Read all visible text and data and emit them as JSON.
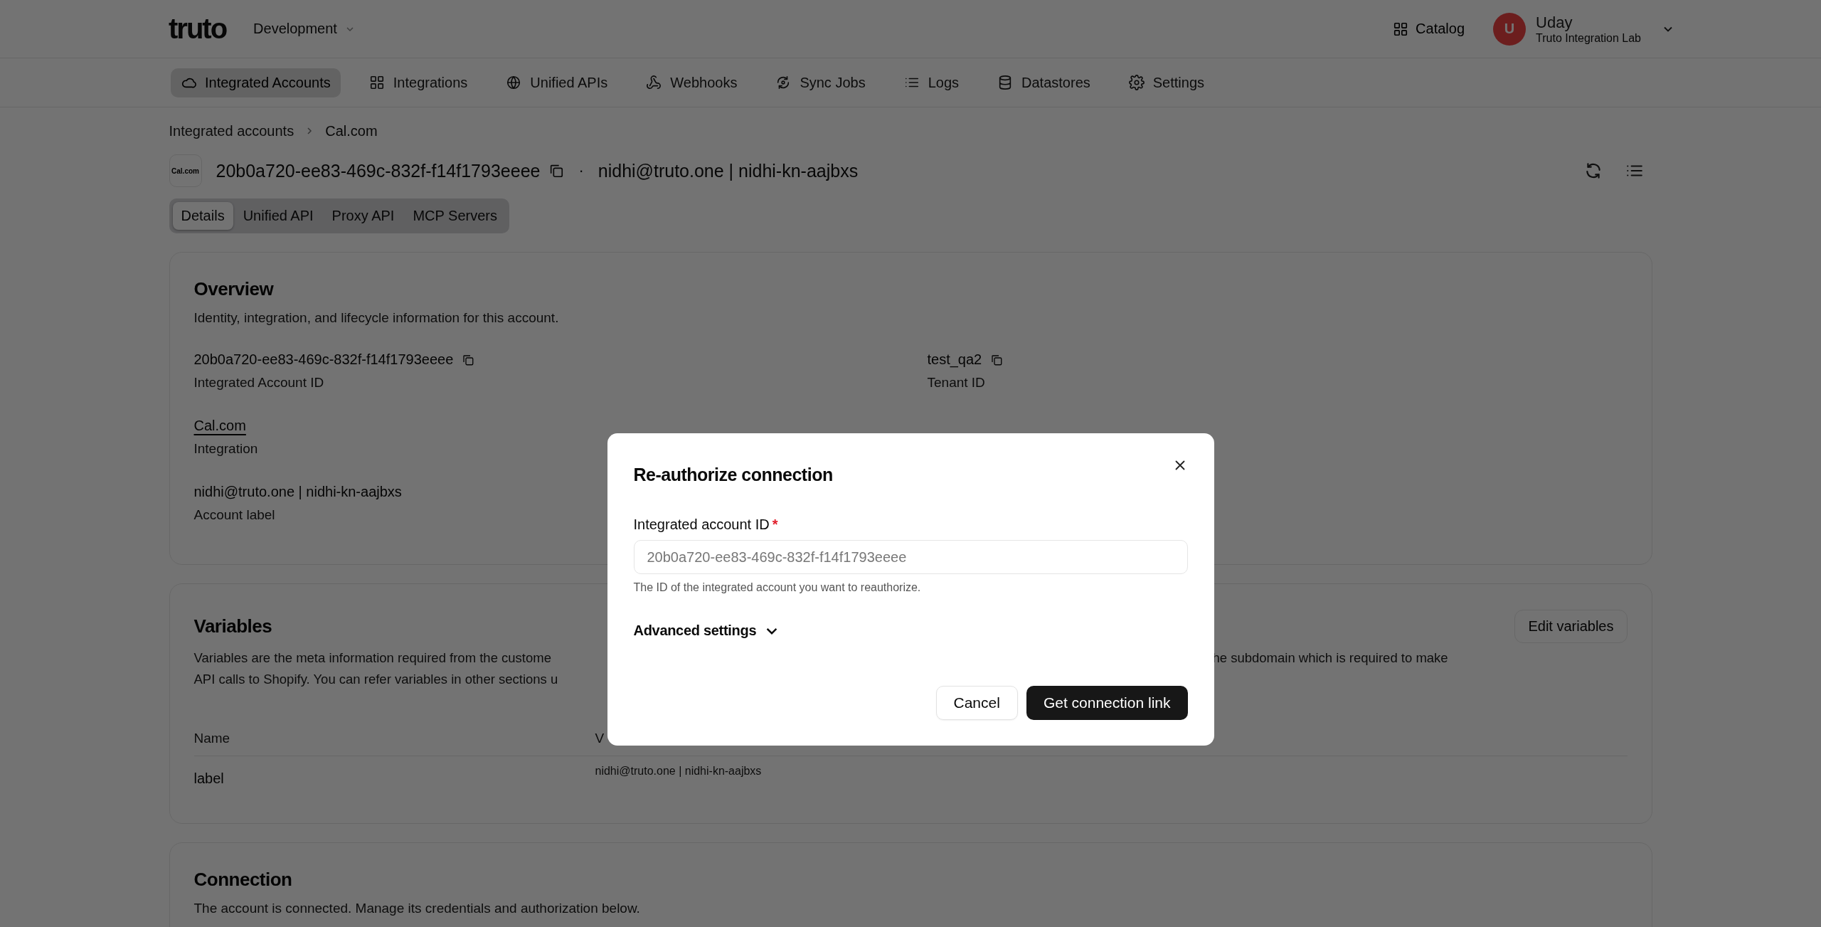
{
  "header": {
    "logo": "truto",
    "environment": "Development",
    "catalog": "Catalog",
    "user": {
      "initial": "U",
      "name": "Uday",
      "org": "Truto Integration Lab"
    }
  },
  "nav": [
    {
      "label": "Integrated Accounts",
      "selected": true
    },
    {
      "label": "Integrations",
      "selected": false
    },
    {
      "label": "Unified APIs",
      "selected": false
    },
    {
      "label": "Webhooks",
      "selected": false
    },
    {
      "label": "Sync Jobs",
      "selected": false
    },
    {
      "label": "Logs",
      "selected": false
    },
    {
      "label": "Datastores",
      "selected": false
    },
    {
      "label": "Settings",
      "selected": false
    }
  ],
  "breadcrumb": [
    "Integrated accounts",
    "Cal.com"
  ],
  "account": {
    "logo_text": "Cal.com",
    "id": "20b0a720-ee83-469c-832f-f14f1793eeee",
    "separator": "·",
    "label": "nidhi@truto.one | nidhi-kn-aajbxs"
  },
  "tabs": [
    {
      "label": "Details",
      "selected": true
    },
    {
      "label": "Unified API",
      "selected": false
    },
    {
      "label": "Proxy API",
      "selected": false
    },
    {
      "label": "MCP Servers",
      "selected": false
    }
  ],
  "overview": {
    "title": "Overview",
    "description": "Identity, integration, and lifecycle information for this account.",
    "columns": [
      [
        {
          "value": "20b0a720-ee83-469c-832f-f14f1793eeee",
          "label": "Integrated Account ID",
          "copyable": true,
          "link": false
        },
        {
          "value": "Cal.com",
          "label": "Integration",
          "copyable": false,
          "link": true
        },
        {
          "value": "nidhi@truto.one | nidhi-kn-aajbxs",
          "label": "Account label",
          "copyable": false,
          "link": false
        }
      ],
      [
        {
          "value": "test_qa2",
          "label": "Tenant ID",
          "copyable": true,
          "link": false
        }
      ]
    ]
  },
  "variables": {
    "title": "Variables",
    "edit_button": "Edit variables",
    "description_lines": [
      {
        "start": "Variables are the meta information required from the custome",
        "end": "he subdomain which is required to make"
      },
      {
        "start": "API calls to Shopify. You can refer variables in other sections u"
      }
    ],
    "columns": [
      "Name",
      "V"
    ],
    "rows": [
      {
        "name": "label",
        "value": "nidhi@truto.one | nidhi-kn-aajbxs"
      }
    ]
  },
  "connection": {
    "title": "Connection",
    "description": "The account is connected. Manage its credentials and authorization below."
  },
  "dialog": {
    "title": "Re-authorize connection",
    "field": {
      "label": "Integrated account ID",
      "required": true,
      "required_mark": "*",
      "value": "20b0a720-ee83-469c-832f-f14f1793eeee",
      "disabled": true,
      "help": "The ID of the integrated account you want to reauthorize."
    },
    "advanced": {
      "label": "Advanced settings",
      "expanded": false
    },
    "cancel": "Cancel",
    "confirm": "Get connection link"
  }
}
